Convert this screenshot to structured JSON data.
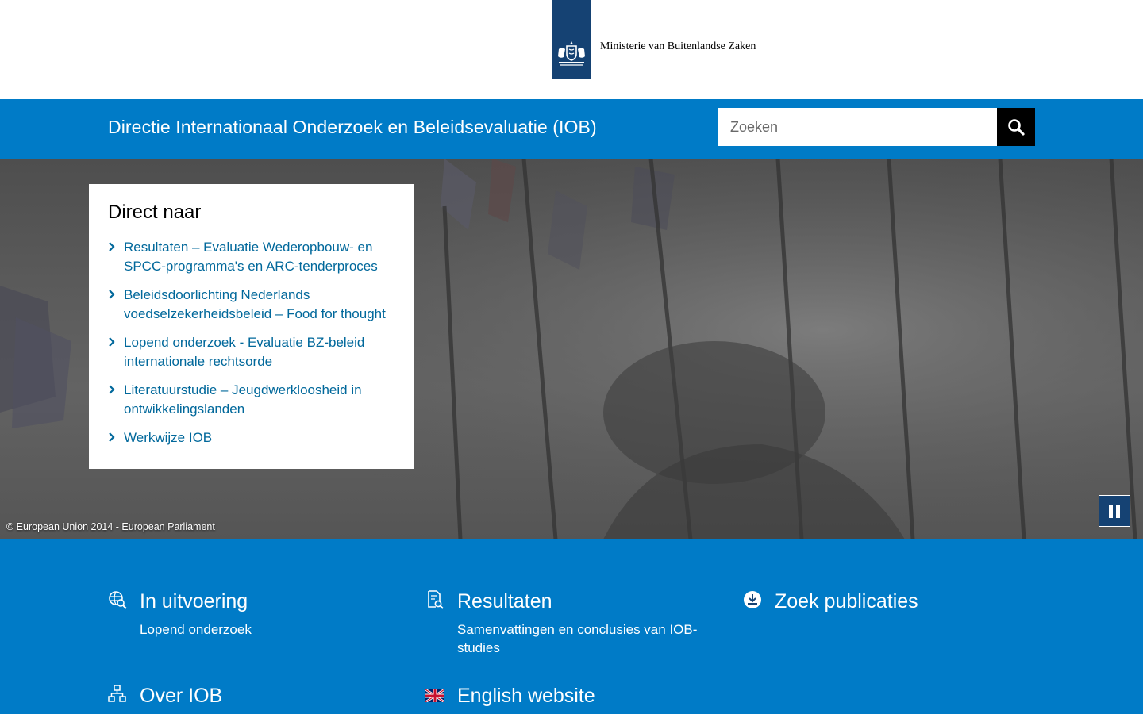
{
  "logo": {
    "ministry_name": "Ministerie van Buitenlandse Zaken",
    "icon": "rijksoverheid-coat-of-arms"
  },
  "header": {
    "site_title": "Directie Internationaal Onderzoek en Beleidsevaluatie (IOB)",
    "search_placeholder": "Zoeken",
    "search_icon": "search-icon",
    "color": "#007bc7"
  },
  "hero": {
    "credit": "© European Union 2014 - European Parliament",
    "pause_icon": "pause-icon"
  },
  "direct_naar": {
    "title": "Direct naar",
    "items": [
      {
        "line1": "Resultaten – Evaluatie Wederopbouw- en",
        "line2": "SPCC-programma's en ARC-tenderproces"
      },
      {
        "line1": "Beleidsdoorlichting Nederlands",
        "line2": "voedselzekerheidsbeleid – Food for thought"
      },
      {
        "line1": "Lopend onderzoek - Evaluatie BZ-beleid",
        "line2": "internationale rechtsorde"
      },
      {
        "line1": "Literatuurstudie – Jeugdwerkloosheid in",
        "line2": "ontwikkelingslanden"
      },
      {
        "line1": "Werkwijze IOB",
        "line2": ""
      }
    ],
    "link_color": "#01689b"
  },
  "tiles": [
    {
      "title": "In uitvoering",
      "desc": "Lopend onderzoek",
      "icon": "globe-search-icon"
    },
    {
      "title": "Resultaten",
      "desc": "Samenvattingen en conclusies van IOB-studies",
      "icon": "document-search-icon"
    },
    {
      "title": "Zoek publicaties",
      "desc": "",
      "icon": "download-icon"
    },
    {
      "title": "Over IOB",
      "desc": "",
      "icon": "organisation-icon"
    },
    {
      "title": "English website",
      "desc": "",
      "icon": "uk-flag-icon"
    }
  ]
}
